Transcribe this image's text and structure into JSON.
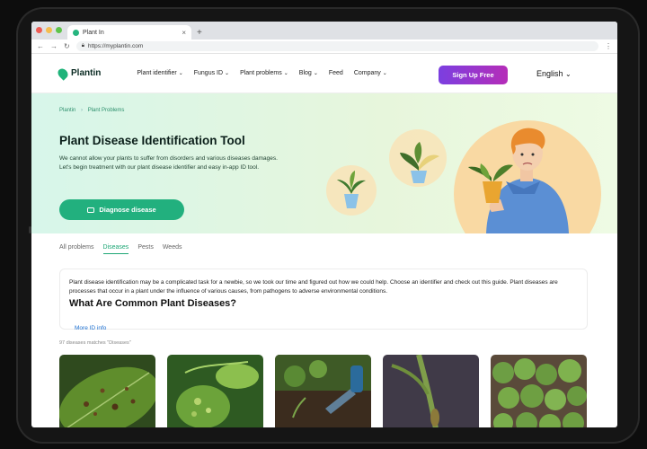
{
  "browser": {
    "tab_title": "Plant In",
    "url": "https://myplantin.com",
    "new_tab": "+",
    "close": "×",
    "menu": "⋮"
  },
  "nav": {
    "logo": "Plantin",
    "links": [
      "Plant identifier",
      "Fungus ID",
      "Plant problems",
      "Blog",
      "Feed",
      "Company"
    ],
    "signup": "Sign Up Free",
    "language": "English"
  },
  "hero": {
    "breadcrumb": [
      "Plantin",
      "Plant Problems"
    ],
    "title": "Plant Disease Identification Tool",
    "description": "We cannot allow your plants to suffer from disorders and various diseases damages. Let's begin treatment with our plant disease identifier and easy in-app ID tool.",
    "button": "Diagnose disease"
  },
  "tabs": [
    "All problems",
    "Diseases",
    "Pests",
    "Weeds"
  ],
  "active_tab": "Diseases",
  "info": {
    "text": "Plant disease identification may be a complicated task for a newbie, so we took our time and figured out how we could help. Choose an identifier and check out this guide. Plant diseases are processes that occur in a plant under the influence of various causes, from pathogens to adverse environmental conditions.",
    "heading": "What Are Common Plant Diseases?",
    "more_link": "More ID info"
  },
  "matches_text": "97 diseases matches \"Diseases\"",
  "cards": [
    {
      "name": "leaf-spot-photo"
    },
    {
      "name": "leaf-gall-photo"
    },
    {
      "name": "seedling-trowel-photo"
    },
    {
      "name": "stem-rot-photo"
    },
    {
      "name": "seedling-tray-photo"
    }
  ],
  "colors": {
    "brand_green": "#22b07e",
    "signup_gradient_start": "#7b3fe0",
    "signup_gradient_end": "#b52db8",
    "link_blue": "#1c6fd0"
  }
}
